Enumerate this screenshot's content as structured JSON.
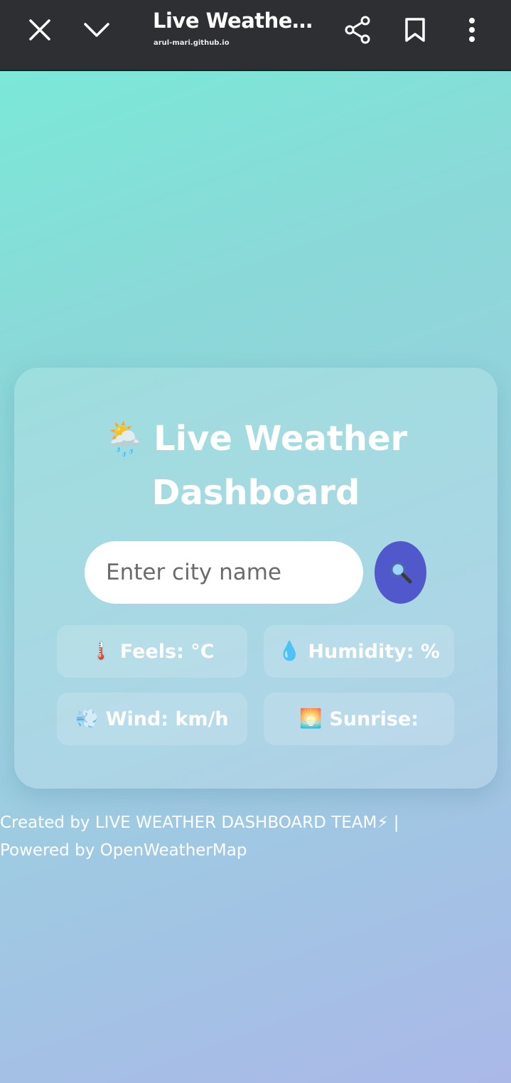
{
  "browser": {
    "title": "Live Weathe…",
    "url": "arul-mari.github.io"
  },
  "icons": {
    "close": "close-icon",
    "collapse": "chevron-down-icon",
    "share": "share-icon",
    "bookmark": "bookmark-icon",
    "more": "more-vertical-icon",
    "search": "search-icon"
  },
  "dashboard": {
    "title_emoji": "🌦️",
    "title_line1": "Live Weather",
    "title_line2": "Dashboard",
    "search_placeholder": "Enter city name",
    "search_button": "🔍"
  },
  "stats": [
    {
      "icon": "🌡️",
      "label": "Feels: °C"
    },
    {
      "icon": "💧",
      "label": "Humidity: %"
    },
    {
      "icon": "💨",
      "label": "Wind: km/h"
    },
    {
      "icon": "🌅",
      "label": "Sunrise:"
    }
  ],
  "footer": {
    "line1": "Created by LIVE WEATHER DASHBOARD TEAM⚡ |",
    "line2": "Powered by OpenWeatherMap"
  },
  "colors": {
    "topbar": "#2e2f33",
    "search_button": "#5158cc",
    "gradient_start": "#77ecd8",
    "gradient_end": "#aab8e8"
  }
}
